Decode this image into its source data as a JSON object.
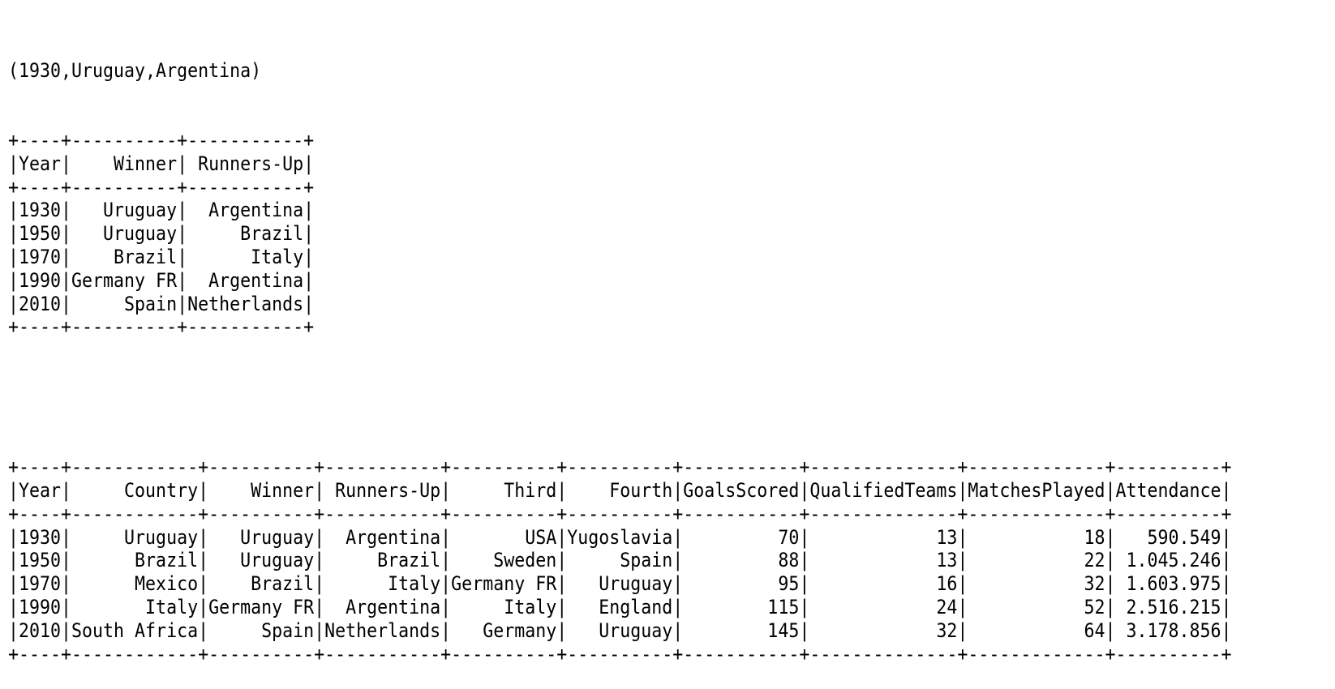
{
  "output_line": "(1930,Uruguay,Argentina)",
  "tables": [
    {
      "id": "finals",
      "columns": [
        {
          "name": "Year",
          "width": 4
        },
        {
          "name": "Winner",
          "width": 10
        },
        {
          "name": "Runners-Up",
          "width": 11
        }
      ],
      "rows": [
        [
          "1930",
          "Uruguay",
          "Argentina"
        ],
        [
          "1950",
          "Uruguay",
          "Brazil"
        ],
        [
          "1970",
          "Brazil",
          "Italy"
        ],
        [
          "1990",
          "Germany FR",
          "Argentina"
        ],
        [
          "2010",
          "Spain",
          "Netherlands"
        ]
      ]
    },
    {
      "id": "world_cups",
      "columns": [
        {
          "name": "Year",
          "width": 4
        },
        {
          "name": "Country",
          "width": 12
        },
        {
          "name": "Winner",
          "width": 10
        },
        {
          "name": "Runners-Up",
          "width": 11
        },
        {
          "name": "Third",
          "width": 10
        },
        {
          "name": "Fourth",
          "width": 10
        },
        {
          "name": "GoalsScored",
          "width": 11
        },
        {
          "name": "QualifiedTeams",
          "width": 14
        },
        {
          "name": "MatchesPlayed",
          "width": 13
        },
        {
          "name": "Attendance",
          "width": 10
        }
      ],
      "rows": [
        [
          "1930",
          "Uruguay",
          "Uruguay",
          "Argentina",
          "USA",
          "Yugoslavia",
          "70",
          "13",
          "18",
          "590.549"
        ],
        [
          "1950",
          "Brazil",
          "Uruguay",
          "Brazil",
          "Sweden",
          "Spain",
          "88",
          "13",
          "22",
          "1.045.246"
        ],
        [
          "1970",
          "Mexico",
          "Brazil",
          "Italy",
          "Germany FR",
          "Uruguay",
          "95",
          "16",
          "32",
          "1.603.975"
        ],
        [
          "1990",
          "Italy",
          "Germany FR",
          "Argentina",
          "Italy",
          "England",
          "115",
          "24",
          "52",
          "2.516.215"
        ],
        [
          "2010",
          "South Africa",
          "Spain",
          "Netherlands",
          "Germany",
          "Uruguay",
          "145",
          "32",
          "64",
          "3.178.856"
        ]
      ]
    }
  ]
}
